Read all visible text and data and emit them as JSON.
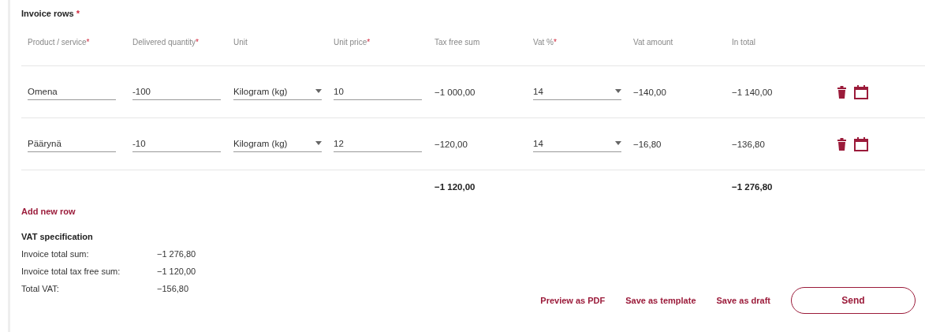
{
  "section": {
    "title": "Invoice rows",
    "mark": "*"
  },
  "columns": [
    {
      "label": "Product / service",
      "mark": "*"
    },
    {
      "label": "Delivered quantity",
      "mark": "*"
    },
    {
      "label": "Unit"
    },
    {
      "label": "Unit price",
      "mark": "*"
    },
    {
      "label": "Tax free sum"
    },
    {
      "label": "Vat %",
      "mark": "*"
    },
    {
      "label": "Vat amount"
    },
    {
      "label": "In total"
    }
  ],
  "rows": [
    {
      "product": "Omena",
      "quantity": "-100",
      "unit": "Kilogram (kg)",
      "unit_price": "10",
      "tax_free_sum": "−1 000,00",
      "vat": "14",
      "vat_amount": "−140,00",
      "total": "−1 140,00"
    },
    {
      "product": "Päärynä",
      "quantity": "-10",
      "unit": "Kilogram (kg)",
      "unit_price": "12",
      "tax_free_sum": "−120,00",
      "vat": "14",
      "vat_amount": "−16,80",
      "total": "−136,80"
    }
  ],
  "totals": {
    "tax_free_sum": "−1 120,00",
    "total": "−1 276,80"
  },
  "add_row": "Add new row",
  "vat_specification": {
    "title": "VAT specification",
    "lines": [
      {
        "label": "Invoice total sum:",
        "value": "−1 276,80"
      },
      {
        "label": "Invoice total tax free sum:",
        "value": "−1 120,00"
      },
      {
        "label": "Total VAT:",
        "value": "−156,80"
      }
    ]
  },
  "actions": [
    {
      "label": "Preview as PDF",
      "kind": "link"
    },
    {
      "label": "Save as template",
      "kind": "link"
    },
    {
      "label": "Save as draft",
      "kind": "link"
    },
    {
      "label": "Send",
      "kind": "outlined"
    }
  ]
}
